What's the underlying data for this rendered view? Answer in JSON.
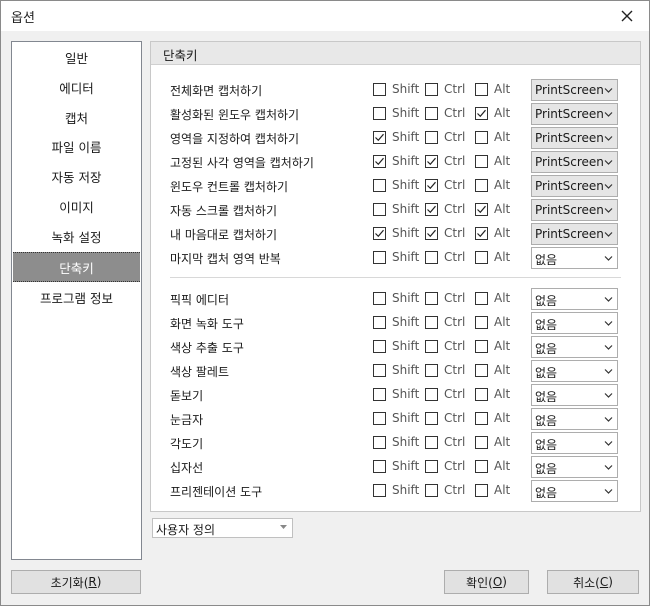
{
  "window": {
    "title": "옵션"
  },
  "sidebar": {
    "items": [
      {
        "label": "일반",
        "active": false
      },
      {
        "label": "에디터",
        "active": false
      },
      {
        "label": "캡처",
        "active": false
      },
      {
        "label": "파일 이름",
        "active": false
      },
      {
        "label": "자동 저장",
        "active": false
      },
      {
        "label": "이미지",
        "active": false
      },
      {
        "label": "녹화 설정",
        "active": false
      },
      {
        "label": "단축키",
        "active": true
      },
      {
        "label": "프로그램 정보",
        "active": false
      }
    ]
  },
  "panel": {
    "header": "단축키",
    "modifiers": {
      "shift": "Shift",
      "ctrl": "Ctrl",
      "alt": "Alt"
    },
    "capture_rows": [
      {
        "label": "전체화면 캡처하기",
        "shift": false,
        "ctrl": false,
        "alt": false,
        "key": "PrintScreen"
      },
      {
        "label": "활성화된 윈도우 캡처하기",
        "shift": false,
        "ctrl": false,
        "alt": true,
        "key": "PrintScreen"
      },
      {
        "label": "영역을 지정하여 캡처하기",
        "shift": true,
        "ctrl": false,
        "alt": false,
        "key": "PrintScreen"
      },
      {
        "label": "고정된 사각 영역을 캡처하기",
        "shift": true,
        "ctrl": true,
        "alt": false,
        "key": "PrintScreen"
      },
      {
        "label": "윈도우 컨트롤 캡처하기",
        "shift": false,
        "ctrl": true,
        "alt": false,
        "key": "PrintScreen"
      },
      {
        "label": "자동 스크롤 캡처하기",
        "shift": false,
        "ctrl": true,
        "alt": true,
        "key": "PrintScreen"
      },
      {
        "label": "내 마음대로 캡처하기",
        "shift": true,
        "ctrl": true,
        "alt": true,
        "key": "PrintScreen"
      },
      {
        "label": "마지막 캡처 영역 반복",
        "shift": false,
        "ctrl": false,
        "alt": false,
        "key": "없음"
      }
    ],
    "tool_rows": [
      {
        "label": "픽픽 에디터",
        "shift": false,
        "ctrl": false,
        "alt": false,
        "key": "없음"
      },
      {
        "label": "화면 녹화 도구",
        "shift": false,
        "ctrl": false,
        "alt": false,
        "key": "없음"
      },
      {
        "label": "색상 추출 도구",
        "shift": false,
        "ctrl": false,
        "alt": false,
        "key": "없음"
      },
      {
        "label": "색상 팔레트",
        "shift": false,
        "ctrl": false,
        "alt": false,
        "key": "없음"
      },
      {
        "label": "돋보기",
        "shift": false,
        "ctrl": false,
        "alt": false,
        "key": "없음"
      },
      {
        "label": "눈금자",
        "shift": false,
        "ctrl": false,
        "alt": false,
        "key": "없음"
      },
      {
        "label": "각도기",
        "shift": false,
        "ctrl": false,
        "alt": false,
        "key": "없음"
      },
      {
        "label": "십자선",
        "shift": false,
        "ctrl": false,
        "alt": false,
        "key": "없음"
      },
      {
        "label": "프리젠테이션 도구",
        "shift": false,
        "ctrl": false,
        "alt": false,
        "key": "없음"
      }
    ]
  },
  "preset": {
    "value": "사용자 정의"
  },
  "buttons": {
    "reset": {
      "text": "초기화(",
      "key": "R",
      "tail": ")"
    },
    "ok": {
      "text": "확인(",
      "key": "O",
      "tail": ")"
    },
    "cancel": {
      "text": "취소(",
      "key": "C",
      "tail": ")"
    }
  },
  "icons": {
    "close": "close-icon",
    "check": "check-icon",
    "dropdown": "chevron-down-icon"
  }
}
